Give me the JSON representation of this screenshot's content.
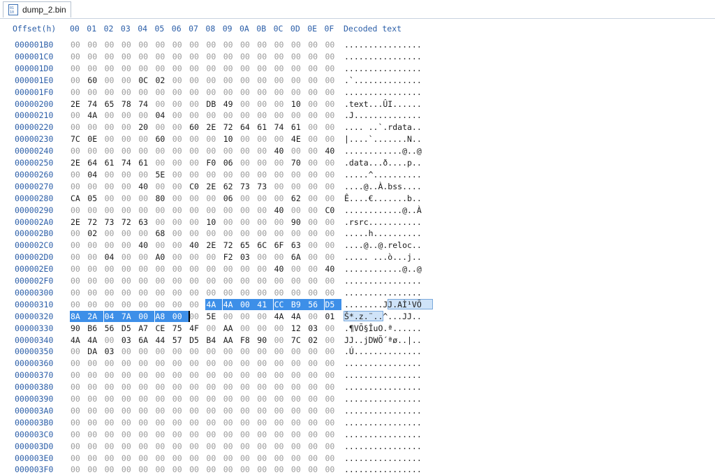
{
  "tab": {
    "label": "dump_2.bin",
    "icon": "binary-file-icon"
  },
  "header": {
    "offset_label": "Offset(h)",
    "columns": [
      "00",
      "01",
      "02",
      "03",
      "04",
      "05",
      "06",
      "07",
      "08",
      "09",
      "0A",
      "0B",
      "0C",
      "0D",
      "0E",
      "0F"
    ],
    "decoded_label": "Decoded text"
  },
  "rows": [
    {
      "offset": "000001B0",
      "bytes": "00 00 00 00 00 00 00 00 00 00 00 00 00 00 00 00",
      "text": "................"
    },
    {
      "offset": "000001C0",
      "bytes": "00 00 00 00 00 00 00 00 00 00 00 00 00 00 00 00",
      "text": "................"
    },
    {
      "offset": "000001D0",
      "bytes": "00 00 00 00 00 00 00 00 00 00 00 00 00 00 00 00",
      "text": "................"
    },
    {
      "offset": "000001E0",
      "bytes": "00 60 00 00 0C 02 00 00 00 00 00 00 00 00 00 00",
      "text": ".`.............."
    },
    {
      "offset": "000001F0",
      "bytes": "00 00 00 00 00 00 00 00 00 00 00 00 00 00 00 00",
      "text": "................"
    },
    {
      "offset": "00000200",
      "bytes": "2E 74 65 78 74 00 00 00 DB 49 00 00 00 10 00 00",
      "text": ".text...ÛI......"
    },
    {
      "offset": "00000210",
      "bytes": "00 4A 00 00 00 04 00 00 00 00 00 00 00 00 00 00",
      "text": ".J.............."
    },
    {
      "offset": "00000220",
      "bytes": "00 00 00 00 20 00 00 60 2E 72 64 61 74 61 00 00",
      "text": ".... ..`.rdata.."
    },
    {
      "offset": "00000230",
      "bytes": "7C 0E 00 00 00 60 00 00 00 10 00 00 00 4E 00 00",
      "text": "|....`.......N.."
    },
    {
      "offset": "00000240",
      "bytes": "00 00 00 00 00 00 00 00 00 00 00 00 40 00 00 40",
      "text": "............@..@"
    },
    {
      "offset": "00000250",
      "bytes": "2E 64 61 74 61 00 00 00 F0 06 00 00 00 70 00 00",
      "text": ".data...ð....p.."
    },
    {
      "offset": "00000260",
      "bytes": "00 04 00 00 00 5E 00 00 00 00 00 00 00 00 00 00",
      "text": ".....^.........."
    },
    {
      "offset": "00000270",
      "bytes": "00 00 00 00 40 00 00 C0 2E 62 73 73 00 00 00 00",
      "text": "....@..À.bss...."
    },
    {
      "offset": "00000280",
      "bytes": "CA 05 00 00 00 80 00 00 00 06 00 00 00 62 00 00",
      "text": "Ê....€.......b.."
    },
    {
      "offset": "00000290",
      "bytes": "00 00 00 00 00 00 00 00 00 00 00 00 40 00 00 C0",
      "text": "............@..À"
    },
    {
      "offset": "000002A0",
      "bytes": "2E 72 73 72 63 00 00 00 10 00 00 00 00 90 00 00",
      "text": ".rsrc..........."
    },
    {
      "offset": "000002B0",
      "bytes": "00 02 00 00 00 68 00 00 00 00 00 00 00 00 00 00",
      "text": ".....h.........."
    },
    {
      "offset": "000002C0",
      "bytes": "00 00 00 00 40 00 00 40 2E 72 65 6C 6F 63 00 00",
      "text": "....@..@.reloc.."
    },
    {
      "offset": "000002D0",
      "bytes": "00 00 04 00 00 A0 00 00 00 F2 03 00 00 6A 00 00",
      "text": "..... ...ò...j.."
    },
    {
      "offset": "000002E0",
      "bytes": "00 00 00 00 00 00 00 00 00 00 00 00 40 00 00 40",
      "text": "............@..@"
    },
    {
      "offset": "000002F0",
      "bytes": "00 00 00 00 00 00 00 00 00 00 00 00 00 00 00 00",
      "text": "................"
    },
    {
      "offset": "00000300",
      "bytes": "00 00 00 00 00 00 00 00 00 00 00 00 00 00 00 00",
      "text": "................"
    },
    {
      "offset": "00000310",
      "bytes": "00 00 00 00 00 00 00 00 4A 4A 00 41 CC B9 56 D5",
      "text": "........JJ.AÌ¹VÕ"
    },
    {
      "offset": "00000320",
      "bytes": "8A 2A 04 7A 00 A8 00 00 5E 00 00 00 4A 4A 00 01",
      "text": "Š*.z.¨..^...JJ.."
    },
    {
      "offset": "00000330",
      "bytes": "90 B6 56 D5 A7 CE 75 4F 00 AA 00 00 00 12 03 00",
      "text": ".¶VÕ§ÎuO.ª......"
    },
    {
      "offset": "00000340",
      "bytes": "4A 4A 00 03 6A 44 57 D5 B4 AA F8 90 00 7C 02 00",
      "text": "JJ..jDWÕ´ªø..|.."
    },
    {
      "offset": "00000350",
      "bytes": "00 DA 03 00 00 00 00 00 00 00 00 00 00 00 00 00",
      "text": ".Ú.............."
    },
    {
      "offset": "00000360",
      "bytes": "00 00 00 00 00 00 00 00 00 00 00 00 00 00 00 00",
      "text": "................"
    },
    {
      "offset": "00000370",
      "bytes": "00 00 00 00 00 00 00 00 00 00 00 00 00 00 00 00",
      "text": "................"
    },
    {
      "offset": "00000380",
      "bytes": "00 00 00 00 00 00 00 00 00 00 00 00 00 00 00 00",
      "text": "................"
    },
    {
      "offset": "00000390",
      "bytes": "00 00 00 00 00 00 00 00 00 00 00 00 00 00 00 00",
      "text": "................"
    },
    {
      "offset": "000003A0",
      "bytes": "00 00 00 00 00 00 00 00 00 00 00 00 00 00 00 00",
      "text": "................"
    },
    {
      "offset": "000003B0",
      "bytes": "00 00 00 00 00 00 00 00 00 00 00 00 00 00 00 00",
      "text": "................"
    },
    {
      "offset": "000003C0",
      "bytes": "00 00 00 00 00 00 00 00 00 00 00 00 00 00 00 00",
      "text": "................"
    },
    {
      "offset": "000003D0",
      "bytes": "00 00 00 00 00 00 00 00 00 00 00 00 00 00 00 00",
      "text": "................"
    },
    {
      "offset": "000003E0",
      "bytes": "00 00 00 00 00 00 00 00 00 00 00 00 00 00 00 00",
      "text": "................"
    },
    {
      "offset": "000003F0",
      "bytes": "00 00 00 00 00 00 00 00 00 00 00 00 00 00 00 00",
      "text": "................"
    }
  ],
  "selection": {
    "start": "00000318",
    "end": "00000326"
  },
  "colors": {
    "offset": "#2b5ea8",
    "selection": "#3d8fe8",
    "zero_byte": "#9a9a9a"
  }
}
